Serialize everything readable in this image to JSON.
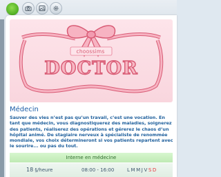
{
  "toolbar": {
    "logo_icon": "plumbob-logo-icon",
    "buttons": [
      {
        "name": "camera-icon",
        "glyph": "◉"
      },
      {
        "name": "gallery-icon",
        "glyph": "▣"
      },
      {
        "name": "settings-icon",
        "glyph": "⚙"
      }
    ]
  },
  "banner": {
    "brand": "choossims",
    "title": "DOCTOR",
    "colors": {
      "background": "#fde4ea",
      "ribbon": "#f7b3c2",
      "ribbon_outline": "#d85a74"
    }
  },
  "career": {
    "title": "Médecin",
    "description": "Sauver des vies n’est pas qu’un travail, c’est une vocation. En tant que médecin, vous diagnostiquerez des maladies, soignerez des patients, réaliserez des opérations et gérerez le chaos d’un hôpital animé. De stagiaire nerveux à spécialiste de renommée mondiale, vos choix détermineront si vos patients repartent avec le sourire... ou pas du tout.",
    "level_name": "Interne en médecine",
    "pay_amount": "18",
    "pay_unit": "§/heure",
    "hours": "08:00 - 16:00",
    "workdays": "LMMJV",
    "days_off": "SD"
  }
}
